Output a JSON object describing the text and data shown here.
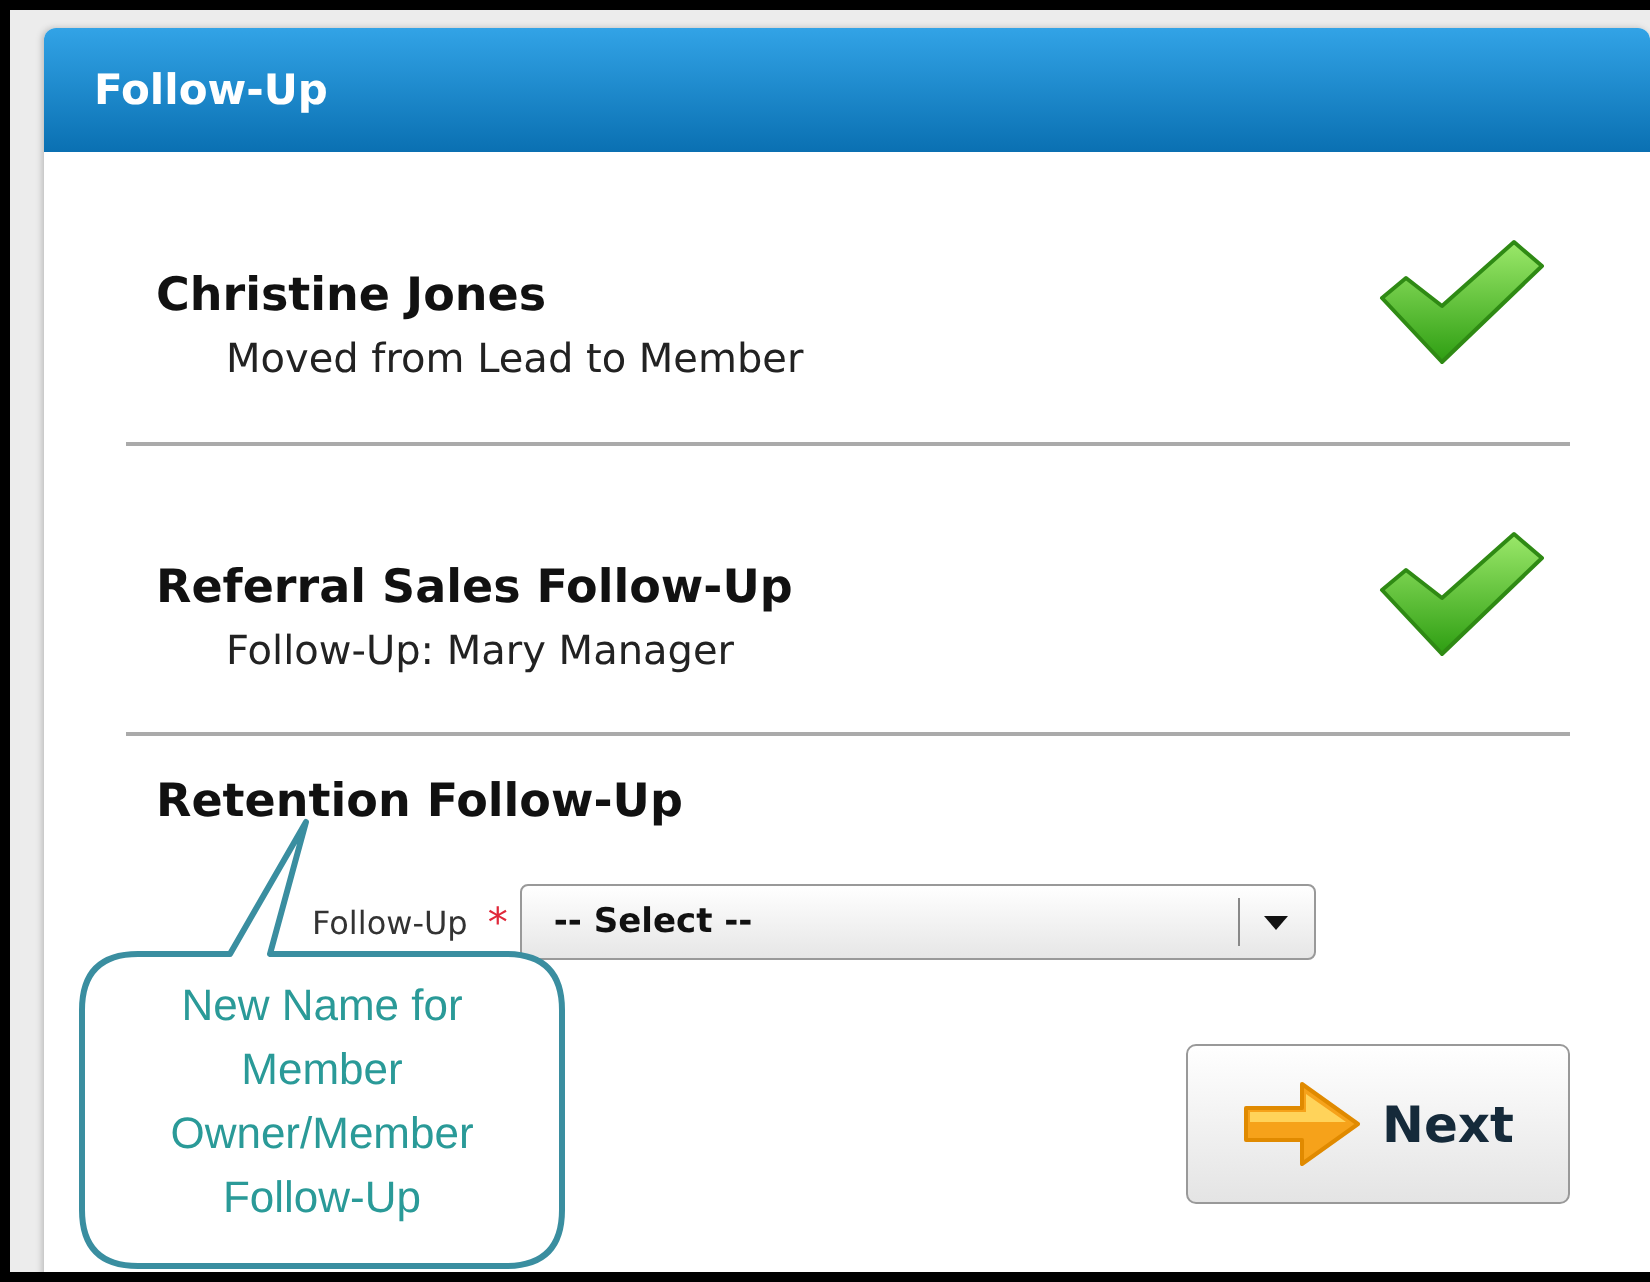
{
  "dialog": {
    "title": "Follow-Up"
  },
  "sections": [
    {
      "kind": "status",
      "title": "Christine Jones",
      "subtitle": "Moved from Lead to Member",
      "done": true
    },
    {
      "kind": "status",
      "title": "Referral Sales Follow-Up",
      "subtitle": "Follow-Up: Mary Manager",
      "done": true
    },
    {
      "kind": "select",
      "title": "Retention Follow-Up",
      "field": {
        "label": "Follow-Up",
        "required": true,
        "required_mark": "*",
        "value": "-- Select --"
      }
    }
  ],
  "next_button": {
    "label": "Next"
  },
  "callout": {
    "text": "New Name for Member Owner/Member Follow-Up"
  }
}
